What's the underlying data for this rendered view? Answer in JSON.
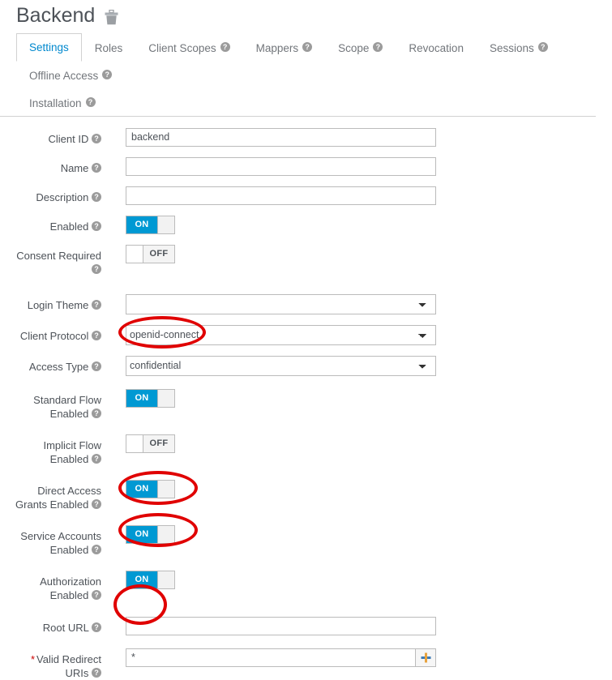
{
  "header": {
    "title": "Backend",
    "delete_icon": "trash-icon"
  },
  "tabs": [
    {
      "label": "Settings",
      "help": false,
      "active": true
    },
    {
      "label": "Roles",
      "help": false,
      "active": false
    },
    {
      "label": "Client Scopes",
      "help": true,
      "active": false
    },
    {
      "label": "Mappers",
      "help": true,
      "active": false
    },
    {
      "label": "Scope",
      "help": true,
      "active": false
    },
    {
      "label": "Revocation",
      "help": false,
      "active": false
    },
    {
      "label": "Sessions",
      "help": true,
      "active": false
    },
    {
      "label": "Offline Access",
      "help": true,
      "active": false
    },
    {
      "label": "Installation",
      "help": true,
      "active": false
    }
  ],
  "help_glyph": "?",
  "form": {
    "client_id": {
      "label": "Client ID",
      "value": "backend",
      "placeholder": ""
    },
    "name": {
      "label": "Name",
      "value": "",
      "placeholder": ""
    },
    "description": {
      "label": "Description",
      "value": "",
      "placeholder": ""
    },
    "enabled": {
      "label": "Enabled",
      "state": "ON"
    },
    "consent_required": {
      "label": "Consent Required",
      "state": "OFF"
    },
    "login_theme": {
      "label": "Login Theme",
      "value": ""
    },
    "client_protocol": {
      "label": "Client Protocol",
      "value": "openid-connect"
    },
    "access_type": {
      "label": "Access Type",
      "value": "confidential"
    },
    "standard_flow_enabled": {
      "label_1": "Standard Flow",
      "label_2": "Enabled",
      "state": "ON"
    },
    "implicit_flow_enabled": {
      "label_1": "Implicit Flow",
      "label_2": "Enabled",
      "state": "OFF"
    },
    "direct_access_grants_enabled": {
      "label_1": "Direct Access",
      "label_2": "Grants Enabled",
      "state": "ON"
    },
    "service_accounts_enabled": {
      "label_1": "Service Accounts",
      "label_2": "Enabled",
      "state": "ON"
    },
    "authorization_enabled": {
      "label_1": "Authorization",
      "label_2": "Enabled",
      "state": "ON"
    },
    "root_url": {
      "label": "Root URL",
      "value": "",
      "placeholder": ""
    },
    "valid_redirect_uris": {
      "required_marker": "*",
      "label_1": "Valid Redirect",
      "label_2": "URIs",
      "value": "*",
      "placeholder": "",
      "add_button": "+"
    }
  },
  "colors": {
    "accent_blue": "#0099d3",
    "tab_active_text": "#0088ce",
    "annotation_red": "#e00000",
    "required_red": "#cc0000",
    "label_gray": "#4d5258"
  }
}
